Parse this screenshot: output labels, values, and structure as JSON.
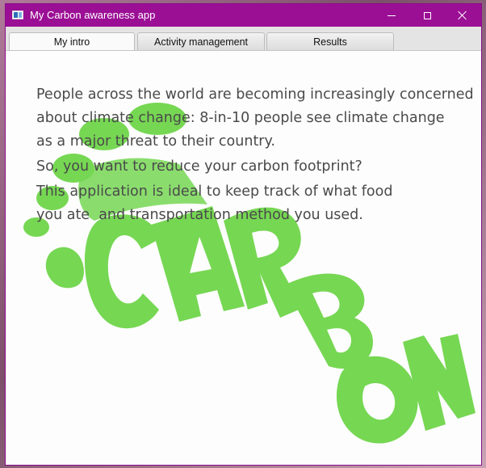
{
  "window": {
    "title": "My Carbon awareness app",
    "title_bar_color": "#9b0f95",
    "controls": [
      "minimize-icon",
      "maximize-icon",
      "close-icon"
    ]
  },
  "tabs": [
    {
      "label": "My intro",
      "active": true
    },
    {
      "label": "Activity management",
      "active": false
    },
    {
      "label": "Results",
      "active": false
    }
  ],
  "intro": {
    "lines": [
      "People across the world are becoming increasingly concerned",
      "about climate change: 8-in-10 people see climate change",
      "as a major threat to their country.",
      "So, you want to reduce your carbon footprint?",
      "This application is ideal to keep track of what food",
      "you ate  and transportation method you used."
    ]
  },
  "background_art": {
    "description_icon": "carbon-footprint-artwork",
    "color": "#6fd54a",
    "letters": [
      "C",
      "A",
      "R",
      "B",
      "O",
      "N"
    ]
  }
}
